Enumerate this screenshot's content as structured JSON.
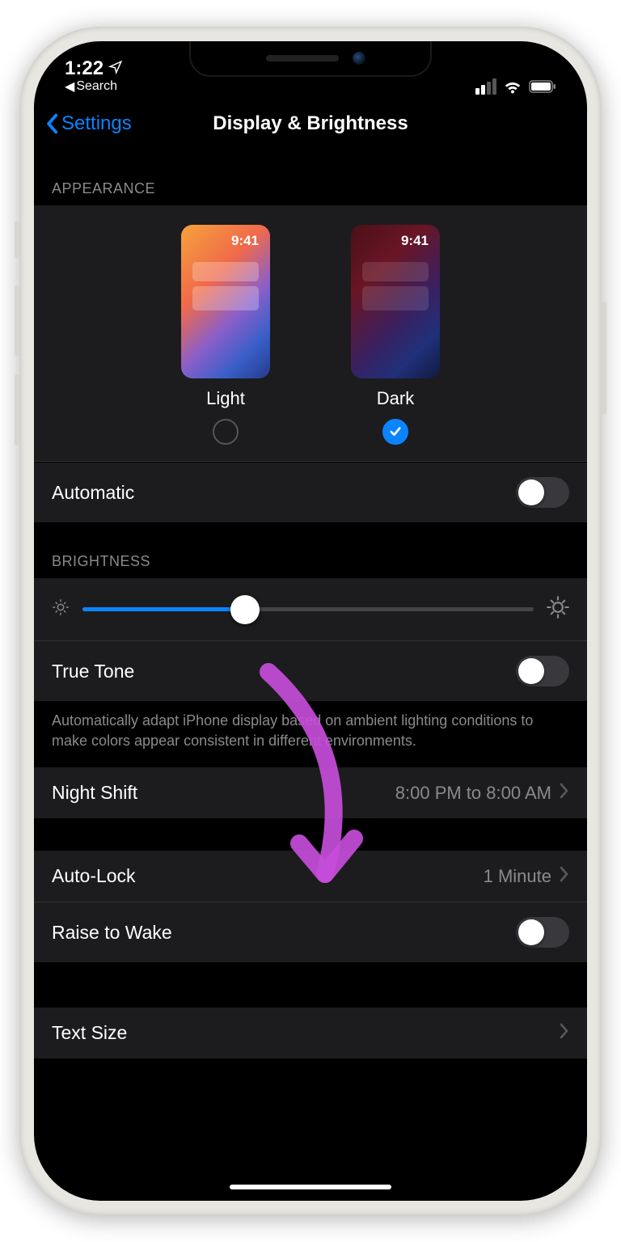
{
  "status": {
    "time": "1:22",
    "back_app": "Search"
  },
  "nav": {
    "back": "Settings",
    "title": "Display & Brightness"
  },
  "appearance": {
    "header": "APPEARANCE",
    "preview_time": "9:41",
    "light_label": "Light",
    "dark_label": "Dark",
    "selected": "dark",
    "automatic_label": "Automatic",
    "automatic_on": false
  },
  "brightness": {
    "header": "BRIGHTNESS",
    "value_percent": 36,
    "true_tone_label": "True Tone",
    "true_tone_on": false,
    "footer": "Automatically adapt iPhone display based on ambient lighting conditions to make colors appear consistent in different environments."
  },
  "night_shift": {
    "label": "Night Shift",
    "value": "8:00 PM to 8:00 AM"
  },
  "auto_lock": {
    "label": "Auto-Lock",
    "value": "1 Minute"
  },
  "raise_to_wake": {
    "label": "Raise to Wake",
    "on": false
  },
  "text_size": {
    "label": "Text Size"
  }
}
